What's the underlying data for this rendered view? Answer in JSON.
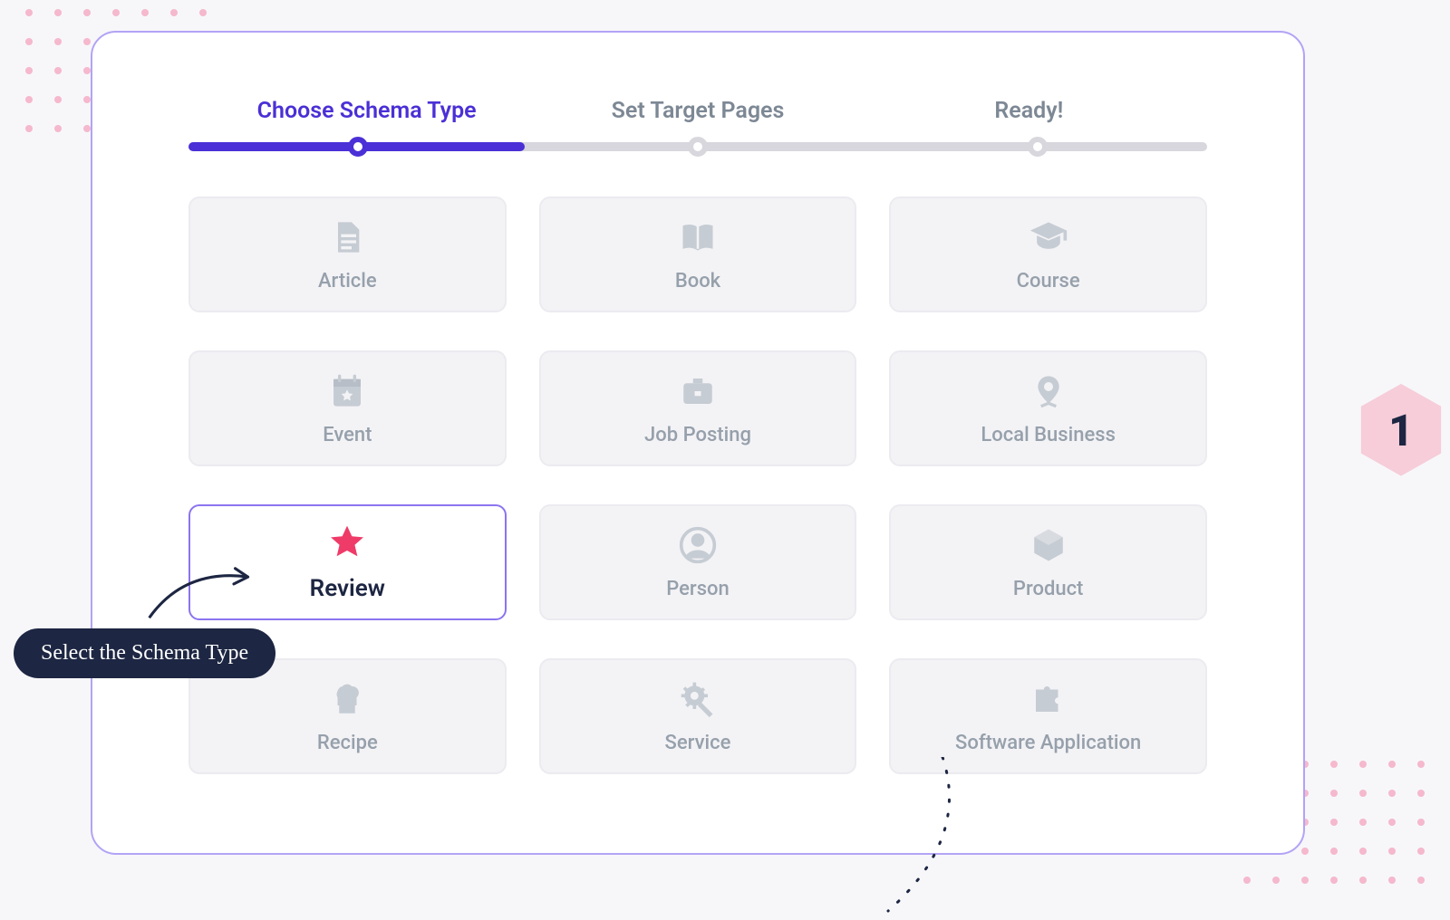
{
  "stepper": {
    "steps": [
      {
        "label": "Choose Schema Type",
        "active": true
      },
      {
        "label": "Set Target Pages",
        "active": false
      },
      {
        "label": "Ready!",
        "active": false
      }
    ],
    "progress_fraction": 0.33
  },
  "tiles": [
    {
      "id": "article",
      "label": "Article",
      "icon": "document-icon",
      "selected": false
    },
    {
      "id": "book",
      "label": "Book",
      "icon": "book-icon",
      "selected": false
    },
    {
      "id": "course",
      "label": "Course",
      "icon": "grad-cap-icon",
      "selected": false
    },
    {
      "id": "event",
      "label": "Event",
      "icon": "calendar-star-icon",
      "selected": false
    },
    {
      "id": "job",
      "label": "Job Posting",
      "icon": "briefcase-icon",
      "selected": false
    },
    {
      "id": "local",
      "label": "Local Business",
      "icon": "map-pin-icon",
      "selected": false
    },
    {
      "id": "review",
      "label": "Review",
      "icon": "star-icon",
      "selected": true
    },
    {
      "id": "person",
      "label": "Person",
      "icon": "user-circle-icon",
      "selected": false
    },
    {
      "id": "product",
      "label": "Product",
      "icon": "box-icon",
      "selected": false
    },
    {
      "id": "recipe",
      "label": "Recipe",
      "icon": "chef-hat-icon",
      "selected": false
    },
    {
      "id": "service",
      "label": "Service",
      "icon": "gear-wrench-icon",
      "selected": false
    },
    {
      "id": "software",
      "label": "Software Application",
      "icon": "puzzle-icon",
      "selected": false
    }
  ],
  "callout": {
    "text": "Select the Schema Type"
  },
  "badge": {
    "step_number": "1"
  },
  "colors": {
    "accent": "#4a30d6",
    "selected_icon": "#ef3b68",
    "muted": "#96a0ab",
    "panel_border": "#b3a3f5",
    "dark": "#1d2642",
    "pink_dot": "#f5b8cc"
  }
}
